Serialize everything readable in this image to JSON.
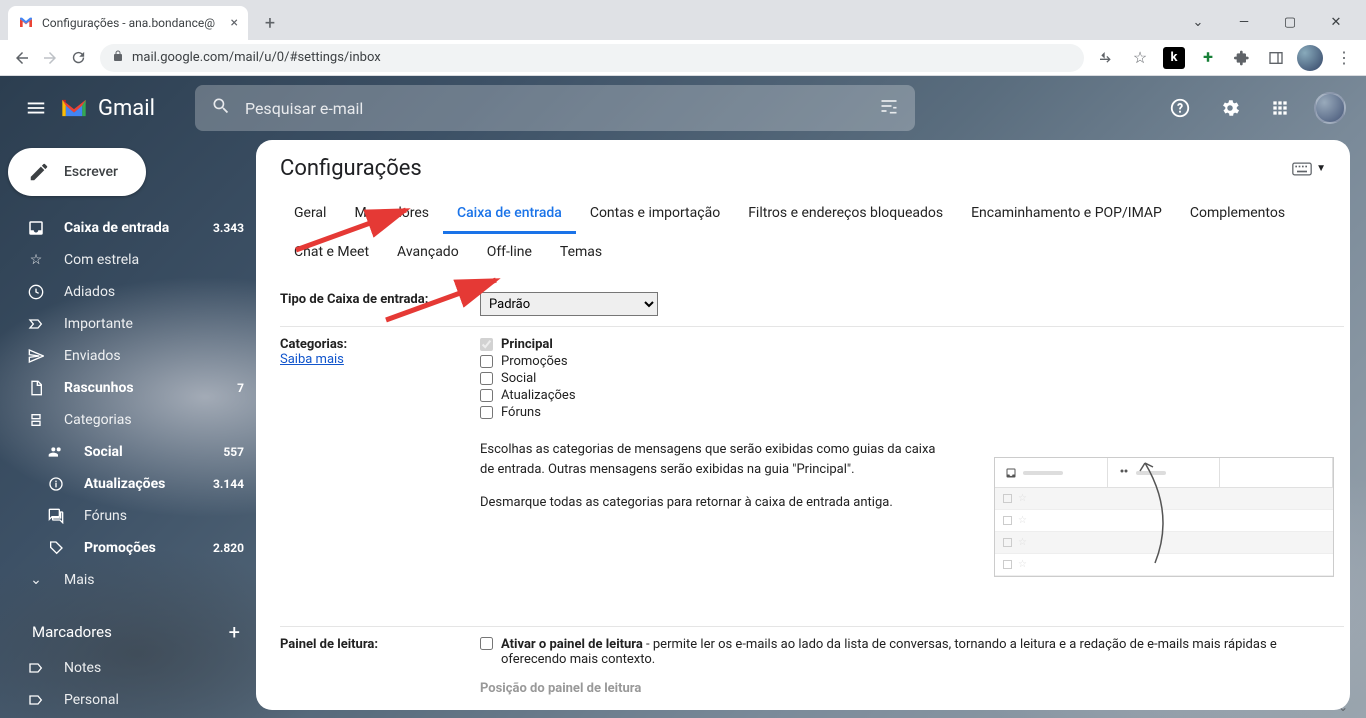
{
  "browser": {
    "tab_title": "Configurações - ana.bondance@",
    "url": "mail.google.com/mail/u/0/#settings/inbox"
  },
  "header": {
    "product": "Gmail",
    "search_placeholder": "Pesquisar e-mail"
  },
  "sidebar": {
    "compose": "Escrever",
    "items": [
      {
        "icon": "inbox",
        "label": "Caixa de entrada",
        "count": "3.343",
        "bold": true
      },
      {
        "icon": "star",
        "label": "Com estrela"
      },
      {
        "icon": "clock",
        "label": "Adiados"
      },
      {
        "icon": "important",
        "label": "Importante"
      },
      {
        "icon": "sent",
        "label": "Enviados"
      },
      {
        "icon": "draft",
        "label": "Rascunhos",
        "count": "7",
        "bold": true
      },
      {
        "icon": "category",
        "label": "Categorias"
      },
      {
        "icon": "people",
        "label": "Social",
        "count": "557",
        "bold": true,
        "indent": true
      },
      {
        "icon": "info",
        "label": "Atualizações",
        "count": "3.144",
        "bold": true,
        "indent": true
      },
      {
        "icon": "forum",
        "label": "Fóruns",
        "indent": true
      },
      {
        "icon": "tag",
        "label": "Promoções",
        "count": "2.820",
        "bold": true,
        "indent": true
      },
      {
        "icon": "chevron",
        "label": "Mais"
      }
    ],
    "labels_header": "Marcadores",
    "labels": [
      {
        "label": "Notes"
      },
      {
        "label": "Personal"
      }
    ]
  },
  "settings": {
    "title": "Configurações",
    "tabs": [
      "Geral",
      "Marcadores",
      "Caixa de entrada",
      "Contas e importação",
      "Filtros e endereços bloqueados",
      "Encaminhamento e POP/IMAP",
      "Complementos",
      "Chat e Meet",
      "Avançado",
      "Off-line",
      "Temas"
    ],
    "active_tab": "Caixa de entrada",
    "inbox_type": {
      "label": "Tipo de Caixa de entrada:",
      "value": "Padrão"
    },
    "categories": {
      "label": "Categorias:",
      "learn_more": "Saiba mais",
      "options": [
        {
          "label": "Principal",
          "checked": true,
          "disabled": true
        },
        {
          "label": "Promoções",
          "checked": false
        },
        {
          "label": "Social",
          "checked": false
        },
        {
          "label": "Atualizações",
          "checked": false
        },
        {
          "label": "Fóruns",
          "checked": false
        }
      ],
      "help1": "Escolhas as categorias de mensagens que serão exibidas como guias da caixa de entrada. Outras mensagens serão exibidas na guia \"Principal\".",
      "help2": "Desmarque todas as categorias para retornar à caixa de entrada antiga."
    },
    "reading_pane": {
      "label": "Painel de leitura:",
      "check_label_bold": "Ativar o painel de leitura",
      "check_label_rest": " - permite ler os e-mails ao lado da lista de conversas, tornando a leitura e a redação de e-mails mais rápidas e oferecendo mais contexto.",
      "position_label": "Posição do painel de leitura"
    }
  }
}
